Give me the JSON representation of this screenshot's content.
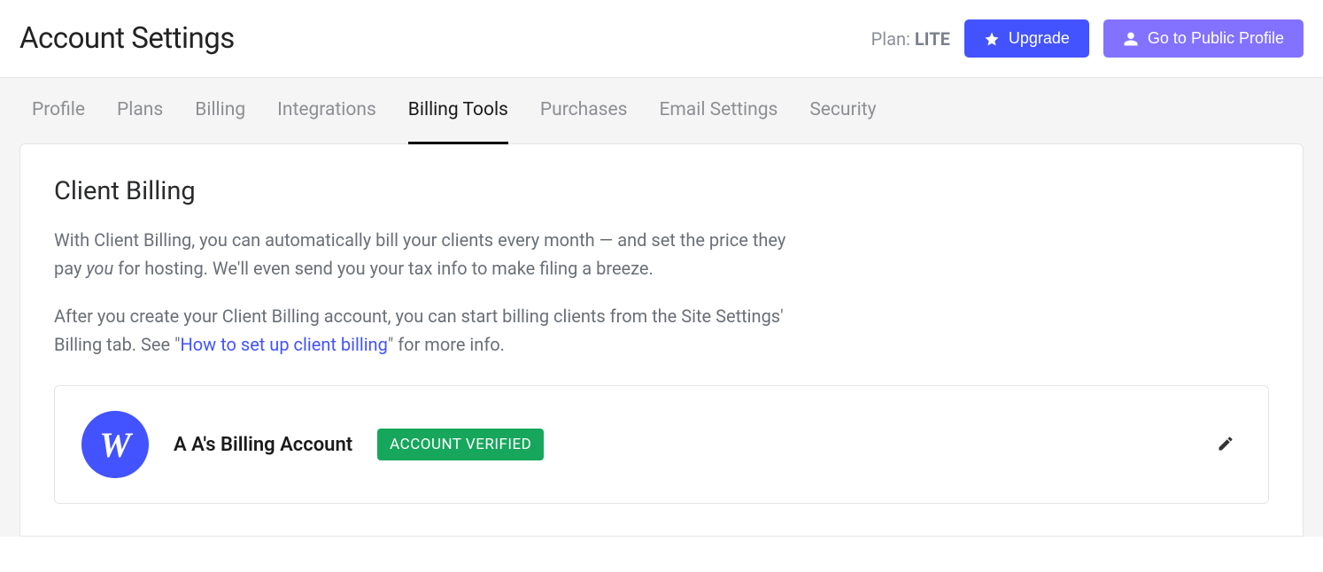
{
  "header": {
    "title": "Account Settings",
    "plan_prefix": "Plan: ",
    "plan_value": "LITE",
    "upgrade_label": "Upgrade",
    "public_profile_label": "Go to Public Profile"
  },
  "tabs": [
    {
      "label": "Profile",
      "active": false
    },
    {
      "label": "Plans",
      "active": false
    },
    {
      "label": "Billing",
      "active": false
    },
    {
      "label": "Integrations",
      "active": false
    },
    {
      "label": "Billing Tools",
      "active": true
    },
    {
      "label": "Purchases",
      "active": false
    },
    {
      "label": "Email Settings",
      "active": false
    },
    {
      "label": "Security",
      "active": false
    }
  ],
  "section": {
    "title": "Client Billing",
    "p1_a": "With Client Billing, you can automatically bill your clients every month — and set the price they pay ",
    "p1_em": "you",
    "p1_b": " for hosting. We'll even send you your tax info to make filing a breeze.",
    "p2_a": "After you create your Client Billing account, you can start billing clients from the Site Settings' Billing tab. See \"",
    "p2_link": "How to set up client billing",
    "p2_b": "\" for more info."
  },
  "account": {
    "avatar_letter": "W",
    "name": "A A's Billing Account",
    "badge": "ACCOUNT VERIFIED"
  }
}
